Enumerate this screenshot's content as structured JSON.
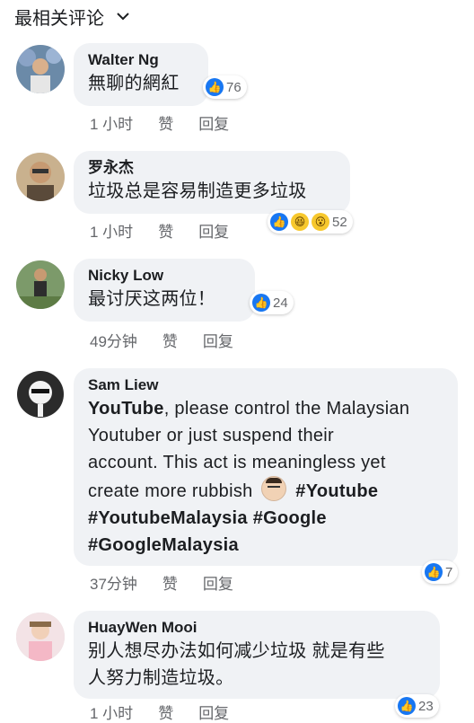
{
  "header": {
    "title": "最相关评论",
    "dropdown_icon": "chevron-down-icon"
  },
  "comments": [
    {
      "author": "Walter Ng",
      "lines": [
        "無聊的網紅"
      ],
      "reactions": {
        "icons": [
          "like"
        ],
        "count": "76"
      },
      "time": "1 小时",
      "like_label": "赞",
      "reply_label": "回复",
      "avatar_color": "#6b8aa8"
    },
    {
      "author": "罗永杰",
      "lines": [
        "垃圾总是容易制造更多垃圾"
      ],
      "reactions": {
        "icons": [
          "like",
          "haha",
          "wow"
        ],
        "count": "52"
      },
      "time": "1 小时",
      "like_label": "赞",
      "reply_label": "回复",
      "avatar_color": "#9a7b5a"
    },
    {
      "author": "Nicky Low",
      "lines": [
        "最讨厌这两位！"
      ],
      "reactions": {
        "icons": [
          "like"
        ],
        "count": "24"
      },
      "time": "49分钟",
      "like_label": "赞",
      "reply_label": "回复",
      "avatar_color": "#6f8d5a"
    },
    {
      "author": "Sam Liew",
      "link_text": "YouTube",
      "body_l1": ", please control the Malaysian",
      "body_l2": "Youtuber or just suspend their",
      "body_l3": "account. This act is meaningless yet",
      "body_l4": "create more rubbish",
      "hashtag_1": "#Youtube",
      "hashtag_2": "#YoutubeMalaysia",
      "hashtag_3": "#Google",
      "hashtag_4": "#GoogleMalaysia",
      "reactions": {
        "icons": [
          "like"
        ],
        "count": "7"
      },
      "time": "37分钟",
      "like_label": "赞",
      "reply_label": "回复",
      "avatar_color": "#2b2b2b"
    },
    {
      "author": "HuayWen Mooi",
      "lines": [
        "别人想尽办法如何减少垃圾 就是有些",
        "人努力制造垃圾。"
      ],
      "reactions": {
        "icons": [
          "like"
        ],
        "count": "23"
      },
      "time": "1 小时",
      "like_label": "赞",
      "reply_label": "回复",
      "avatar_color": "#e9c4c9"
    }
  ]
}
